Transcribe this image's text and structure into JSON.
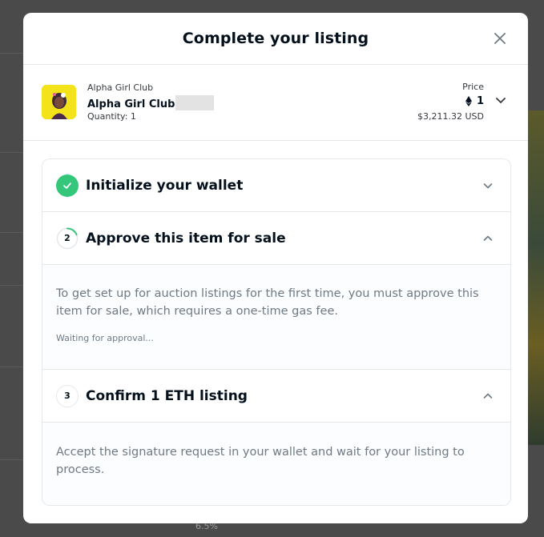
{
  "modal": {
    "title": "Complete your listing"
  },
  "item": {
    "collection": "Alpha Girl Club",
    "name": "Alpha Girl Club",
    "quantity": "Quantity: 1",
    "price_label": "Price",
    "price_eth": "1",
    "price_usd": "$3,211.32 USD",
    "currency_icon": "ethereum-icon"
  },
  "steps": [
    {
      "number": "1",
      "title": "Initialize your wallet",
      "state": "done",
      "expanded": false
    },
    {
      "number": "2",
      "title": "Approve this item for sale",
      "state": "in-progress",
      "expanded": true,
      "description": "To get set up for auction listings for the first time, you must approve this item for sale, which requires a one-time gas fee.",
      "status": "Waiting for approval..."
    },
    {
      "number": "3",
      "title": "Confirm 1 ETH listing",
      "state": "pending",
      "expanded": true,
      "description": "Accept the signature request in your wallet and wait for your listing to process."
    }
  ],
  "background": {
    "footer_text": "6.5%"
  },
  "colors": {
    "success": "#34c77b",
    "border": "#e5e8eb",
    "text_primary": "#04111d",
    "text_secondary": "#707a83",
    "thumb_bg": "#f4e21a"
  }
}
